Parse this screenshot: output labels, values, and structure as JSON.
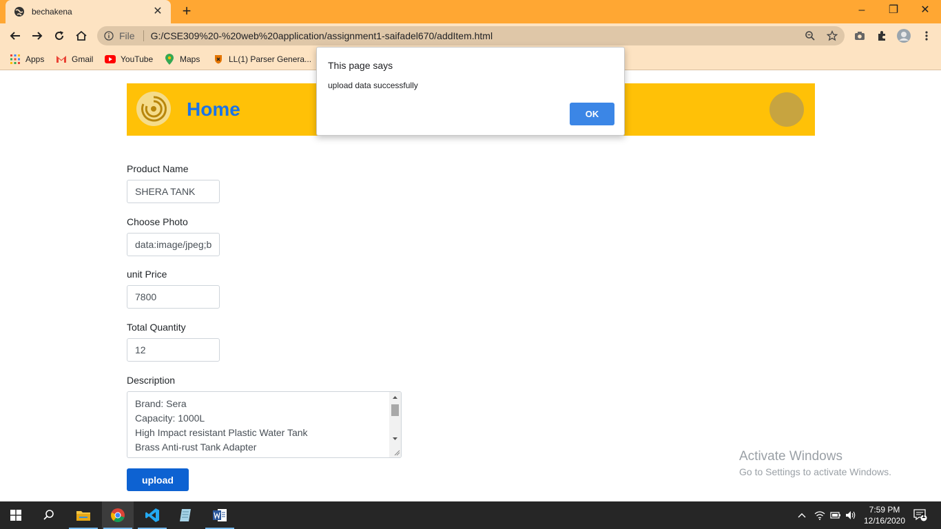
{
  "browser": {
    "tab_title": "bechakena",
    "new_tab": "+",
    "file_label": "File",
    "url": "G:/CSE309%20-%20web%20application/assignment1-saifadel670/addItem.html"
  },
  "bookmarks": [
    {
      "label": "Apps",
      "icon": "apps-grid-icon"
    },
    {
      "label": "Gmail",
      "icon": "gmail-icon"
    },
    {
      "label": "YouTube",
      "icon": "youtube-icon"
    },
    {
      "label": "Maps",
      "icon": "maps-icon"
    },
    {
      "label": "LL(1) Parser Genera...",
      "icon": "parser-icon"
    }
  ],
  "header": {
    "title": "Home"
  },
  "form": {
    "product_name_label": "Product Name",
    "product_name_value": "SHERA TANK",
    "photo_label": "Choose Photo",
    "photo_value": "data:image/jpeg;b",
    "unit_price_label": "unit Price",
    "unit_price_value": "7800",
    "quantity_label": "Total Quantity",
    "quantity_value": "12",
    "description_label": "Description",
    "description_lines": [
      "Brand: Sera",
      "Capacity: 1000L",
      "High Impact resistant Plastic Water Tank",
      "Brass Anti-rust Tank Adapter"
    ],
    "upload_label": "upload"
  },
  "dialog": {
    "title": "This page says",
    "message": "upload data successfully",
    "ok_label": "OK"
  },
  "watermark": {
    "line1": "Activate Windows",
    "line2": "Go to Settings to activate Windows."
  },
  "taskbar": {
    "time": "7:59 PM",
    "date": "12/16/2020",
    "notification_count": "1"
  },
  "colors": {
    "tab_strip": "#ffa733",
    "toolbar": "#fde3c2",
    "header": "#ffc107",
    "home_text": "#1a73e8",
    "upload_button": "#0d62d2",
    "ok_button": "#3b86e6"
  }
}
